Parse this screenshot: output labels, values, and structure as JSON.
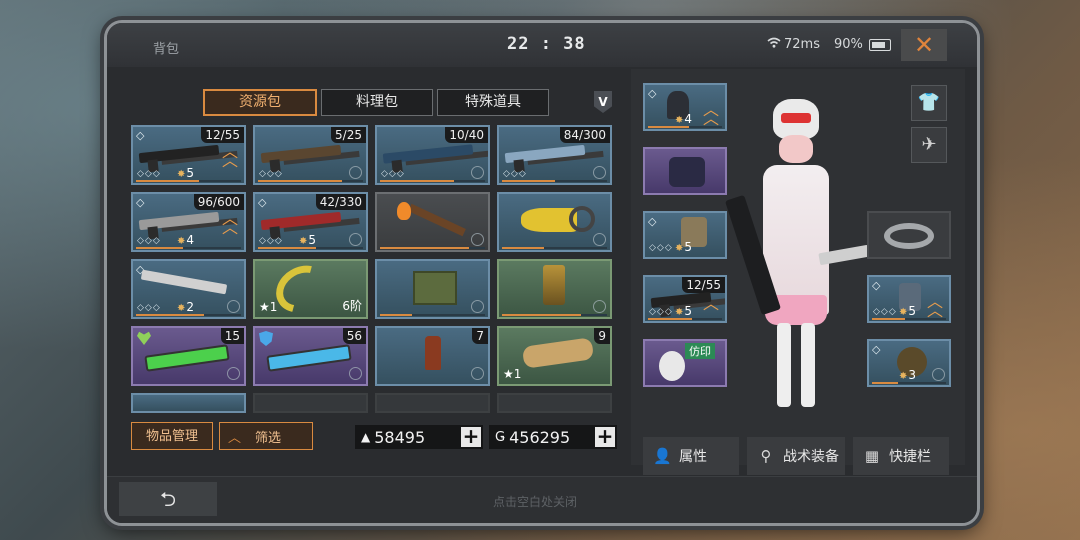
{
  "header": {
    "title": "背包",
    "clock": "22 : 38",
    "ping": "72ms",
    "battery": "90%",
    "close_glyph": "✕"
  },
  "tabs": [
    {
      "label": "资源包",
      "active": true
    },
    {
      "label": "料理包",
      "active": false
    },
    {
      "label": "特殊道具",
      "active": false
    }
  ],
  "v_badge": "V",
  "inventory": [
    {
      "count": "12/55",
      "level": "5",
      "rarity": "blue",
      "icon": "rifle-icon",
      "gem": true,
      "rank": true
    },
    {
      "count": "5/25",
      "level": "",
      "rarity": "blue",
      "icon": "shotgun-icon"
    },
    {
      "count": "10/40",
      "level": "",
      "rarity": "blue",
      "icon": "sniper-icon"
    },
    {
      "count": "84/300",
      "level": "",
      "rarity": "blue",
      "icon": "smg-icon"
    },
    {
      "count": "96/600",
      "level": "4",
      "rarity": "blue",
      "icon": "machinegun-icon",
      "gem": true,
      "rank": true
    },
    {
      "count": "42/330",
      "level": "5",
      "rarity": "blue",
      "icon": "rifle-red-icon",
      "gem": true
    },
    {
      "count": "",
      "level": "",
      "rarity": "gray",
      "icon": "torch-icon"
    },
    {
      "count": "",
      "level": "",
      "rarity": "blue",
      "icon": "chainsaw-icon"
    },
    {
      "count": "",
      "level": "2",
      "rarity": "blue",
      "icon": "machete-icon",
      "gem": true
    },
    {
      "count": "",
      "star": "1",
      "stage": "6阶",
      "rarity": "green",
      "icon": "scythe-icon"
    },
    {
      "count": "",
      "level": "",
      "rarity": "blue",
      "icon": "ammo-crate-icon"
    },
    {
      "count": "",
      "level": "",
      "rarity": "green",
      "icon": "turret-icon"
    },
    {
      "count": "15",
      "level": "",
      "rarity": "purple",
      "icon": "green-syringe-icon",
      "badge": "heart"
    },
    {
      "count": "56",
      "level": "",
      "rarity": "purple",
      "icon": "blue-syringe-icon",
      "badge": "shield"
    },
    {
      "count": "7",
      "level": "",
      "rarity": "blue",
      "icon": "bottle-icon"
    },
    {
      "count": "9",
      "star": "1",
      "rarity": "green",
      "icon": "scroll-icon"
    }
  ],
  "buttons": {
    "manage": "物品管理",
    "filter": "筛选",
    "currency1": "58495",
    "currency2": "456295",
    "plus": "+"
  },
  "footer": {
    "hint": "点击空白处关闭",
    "back_glyph": "⮌"
  },
  "equipment": {
    "left_slots": [
      {
        "level": "4",
        "icon": "helmet-icon",
        "rarity": "blue"
      },
      {
        "level": "",
        "icon": "backpack-icon",
        "rarity": "purple"
      },
      {
        "level": "5",
        "icon": "armor-icon",
        "rarity": "blue"
      },
      {
        "count": "12/55",
        "level": "5",
        "icon": "rifle-icon",
        "rarity": "blue"
      },
      {
        "tag": "仿印",
        "icon": "mask-icon",
        "rarity": "purple"
      }
    ],
    "right_slots": [
      {
        "level": "5",
        "icon": "vest-icon",
        "rarity": "blue"
      },
      {
        "level": "3",
        "icon": "pet-icon",
        "rarity": "blue"
      }
    ]
  },
  "action_buttons": [
    {
      "label": "属性",
      "icon": "person-icon"
    },
    {
      "label": "战术装备",
      "icon": "tripod-icon"
    },
    {
      "label": "快捷栏",
      "icon": "grid-icon"
    }
  ],
  "colors": {
    "accent": "#d98a40",
    "close": "#e0843c"
  }
}
